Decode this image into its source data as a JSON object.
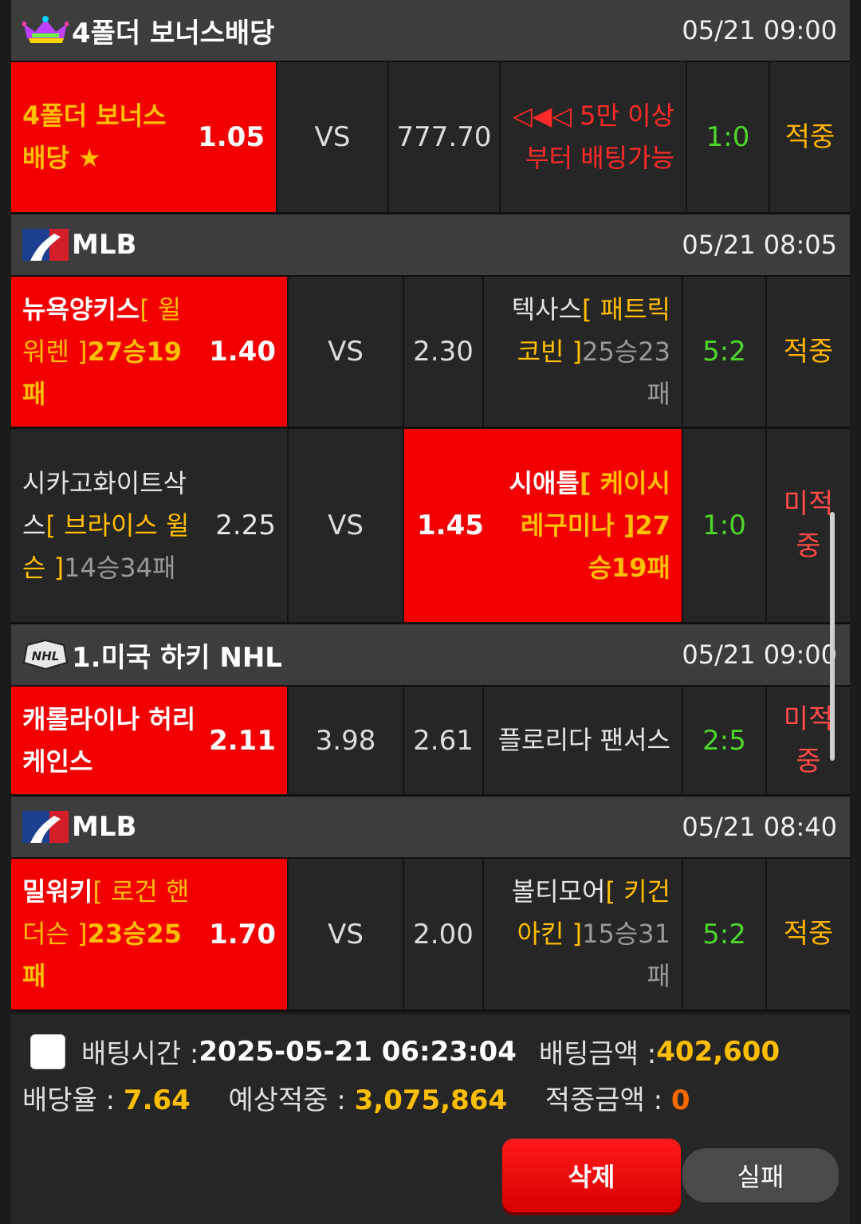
{
  "sections": [
    {
      "league": "4폴더 보너스배당",
      "time": "05/21 09:00",
      "logo": "crown-icon",
      "home_name": "4폴더 보너스배당 ★",
      "home_odd": "1.05",
      "mid": "VS",
      "away_odd": "777.70",
      "away_name": "◁◀◁ 5만 이상 부터 배팅가능",
      "score": "1:0",
      "result": "적중"
    },
    {
      "league": "MLB",
      "time": "05/21 08:05",
      "logo": "mlb-logo-icon",
      "games": [
        {
          "home_name": "뉴욕양키스",
          "home_pitcher": "[ 윌 워렌 ]",
          "home_record": "27승19패",
          "home_odd": "1.40",
          "mid": "VS",
          "away_odd": "2.30",
          "away_name": "텍사스",
          "away_pitcher": "[ 패트릭 코빈 ]",
          "away_record": "25승23패",
          "score": "5:2",
          "result": "적중"
        },
        {
          "home_name": "시카고화이트삭스",
          "home_pitcher": "[ 브라이스 윌슨 ]",
          "home_record": "14승34패",
          "home_odd": "2.25",
          "mid": "VS",
          "away_odd": "1.45",
          "away_name": "시애틀",
          "away_pitcher": "[ 케이시 레구미나 ]",
          "away_record": "27승19패",
          "score": "1:0",
          "result": "미적중"
        }
      ]
    },
    {
      "league": "1.미국 하키 NHL",
      "time": "05/21 09:00",
      "logo": "nhl-logo-icon",
      "home_name": "캐롤라이나 허리케인스",
      "home_odd": "2.11",
      "mid": "3.98",
      "away_odd": "2.61",
      "away_name": "플로리다 팬서스",
      "score": "2:5",
      "result": "미적중"
    },
    {
      "league": "MLB",
      "time": "05/21 08:40",
      "logo": "mlb-logo-icon",
      "home_name": "밀워키",
      "home_pitcher": "[ 로건 핸더슨 ]",
      "home_record": "23승25패",
      "home_odd": "1.70",
      "mid": "VS",
      "away_odd": "2.00",
      "away_name": "볼티모어",
      "away_pitcher": "[ 키건 아킨 ]",
      "away_record": "15승31패",
      "score": "5:2",
      "result": "적중"
    }
  ],
  "footer": {
    "bet_time_label": "배팅시간 : ",
    "bet_time": "2025-05-21 06:23:04",
    "bet_amount_label": "배팅금액 : ",
    "bet_amount": "402,600",
    "odds_label": "배당율 : ",
    "odds": "7.64",
    "expected_label": "예상적중 : ",
    "expected": "3,075,864",
    "win_label": "적중금액 : ",
    "win_amount": "0",
    "delete_label": "삭제",
    "fail_label": "실패"
  },
  "colors": {
    "highlight": "#f20000",
    "score": "#4fd62c",
    "hit": "#ffb400",
    "miss": "#ff4a4a",
    "pitcher": "#ffbf00"
  }
}
